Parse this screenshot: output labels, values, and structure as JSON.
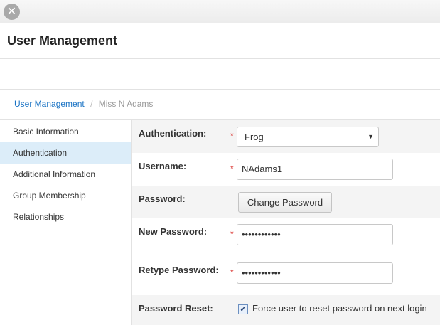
{
  "window": {
    "close_glyph": "✕"
  },
  "header": {
    "title": "User Management"
  },
  "breadcrumb": {
    "parent": "User Management",
    "separator": "/",
    "current": "Miss N Adams"
  },
  "sidebar": {
    "items": [
      {
        "label": "Basic Information",
        "active": false
      },
      {
        "label": "Authentication",
        "active": true
      },
      {
        "label": "Additional Information",
        "active": false
      },
      {
        "label": "Group Membership",
        "active": false
      },
      {
        "label": "Relationships",
        "active": false
      }
    ]
  },
  "form": {
    "required_marker": "*",
    "authentication": {
      "label": "Authentication:",
      "value": "Frog",
      "caret": "▼"
    },
    "username": {
      "label": "Username:",
      "value": "NAdams1"
    },
    "password": {
      "label": "Password:",
      "button": "Change Password"
    },
    "new_password": {
      "label": "New Password:",
      "value": "••••••••••••"
    },
    "retype_password": {
      "label": "Retype Password:",
      "value": "••••••••••••"
    },
    "password_reset": {
      "label": "Password Reset:",
      "checkbox_label": "Force user to reset password on next login",
      "checked": true,
      "check_glyph": "✔"
    }
  },
  "colors": {
    "link": "#1a73c4",
    "required": "#d9302c",
    "active_nav": "#dcedf9"
  }
}
